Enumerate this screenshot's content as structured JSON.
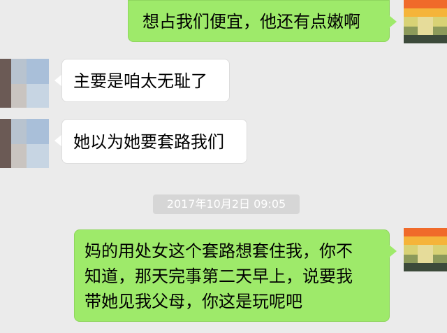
{
  "messages": [
    {
      "sender": "me",
      "text": "想占我们便宜，他还有点嫩啊"
    },
    {
      "sender": "contact",
      "text": "主要是咱太无耻了"
    },
    {
      "sender": "contact",
      "text": "她以为她要套路我们"
    },
    {
      "sender": "me",
      "lines": [
        "妈的用处女这个套路想套住我，你不",
        "知道，那天完事第二天早上，说要我",
        "带她见我父母，你这是玩呢吧"
      ]
    }
  ],
  "timestamp": "2017年10月2日 09:05",
  "colors": {
    "background": "#ebebeb",
    "my_bubble": "#9eea6a",
    "contact_bubble": "#ffffff",
    "timestamp_bg": "#d6d6d6"
  },
  "icons": {
    "my_avatar": "pixelated-avatar-icon",
    "contact_avatar": "pixelated-avatar-icon"
  }
}
